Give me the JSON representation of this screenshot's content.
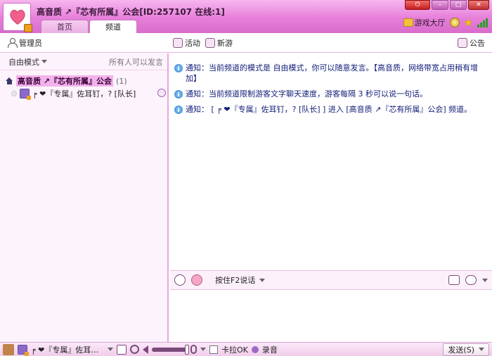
{
  "title": {
    "text": "高音质 ↗『芯有所属』公会[ID:257107 在线:1]"
  },
  "tabs": [
    {
      "label": "首页"
    },
    {
      "label": "频道"
    }
  ],
  "window_buttons": {
    "power": "⏻",
    "minimize": "–",
    "maximize": "□",
    "close": "✕"
  },
  "header_right": {
    "game_hall": "游戏大厅"
  },
  "toolbar": {
    "admin": "管理员",
    "activity": "活动",
    "new_games": "新游",
    "announcement": "公告"
  },
  "left_panel": {
    "mode": "自由模式",
    "mode_note": "所有人可以发言",
    "root_channel": "高音质 ↗『芯有所属』公会",
    "root_count": "(1)",
    "user_entry": "╒ ❤『专属』佐耳钉，? [队长]"
  },
  "chat": {
    "messages": [
      {
        "text": "通知：当前频道的模式是 自由模式，你可以随意发言。【高音质，网络带宽占用稍有增加】"
      },
      {
        "text": "通知：当前频道限制游客文字聊天速度，游客每隔 3 秒可以说一句话。"
      },
      {
        "text": "通知： [ ╒ ❤『专属』佐耳钉，? [队长]  ] 进入 [高音质 ↗『芯有所属』公会] 频道。"
      }
    ]
  },
  "input_toolbar": {
    "push_to_talk": "按住F2说话"
  },
  "bottom_bar": {
    "user_name": "╒ ❤『专属』佐耳…",
    "volume_level": 0.85,
    "karaoke": "卡拉OK",
    "record": "录音",
    "send": "发送(S)"
  },
  "colors": {
    "accent": "#e77fda",
    "panel_bg": "#fdf3fc",
    "highlight": "#f3b2ea",
    "notice_text": "#14207a"
  }
}
